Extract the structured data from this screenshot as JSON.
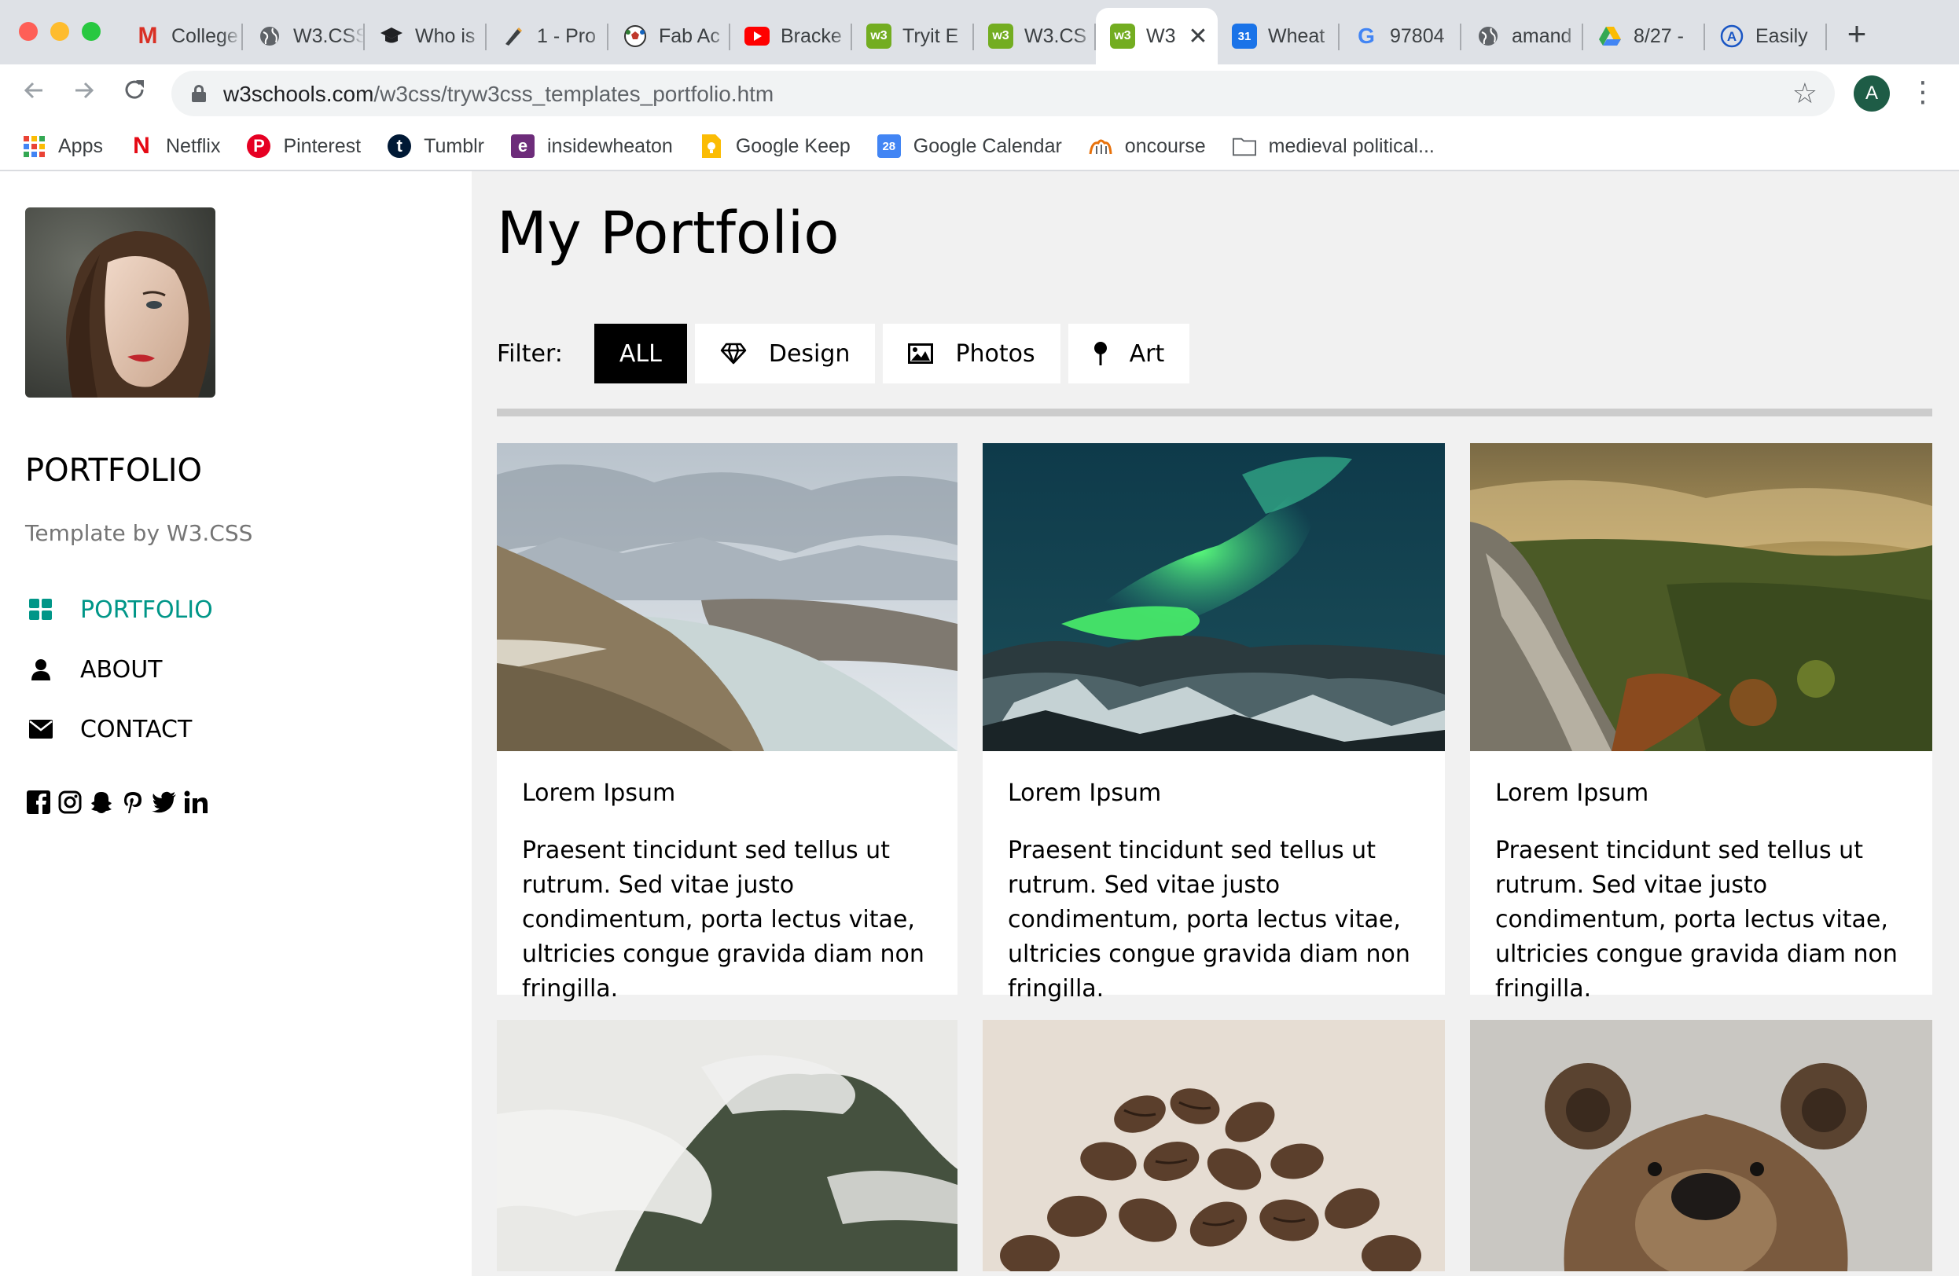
{
  "browser": {
    "tabs": [
      {
        "title": "College",
        "icon": "gmail-icon"
      },
      {
        "title": "W3.CSS",
        "icon": "globe-icon"
      },
      {
        "title": "Who is",
        "icon": "graduation-cap-icon"
      },
      {
        "title": "1 - Pro",
        "icon": "pen-icon"
      },
      {
        "title": "Fab Ac",
        "icon": "soccer-ball-icon"
      },
      {
        "title": "Bracke",
        "icon": "youtube-icon"
      },
      {
        "title": "Tryit E",
        "icon": "w3schools-icon"
      },
      {
        "title": "W3.CS",
        "icon": "w3schools-icon"
      },
      {
        "title": "W3",
        "icon": "w3schools-icon",
        "active": true
      },
      {
        "title": "Wheat",
        "icon": "calendar-icon"
      },
      {
        "title": "97804",
        "icon": "google-icon"
      },
      {
        "title": "amand",
        "icon": "globe-icon"
      },
      {
        "title": "8/27 -",
        "icon": "drive-icon"
      },
      {
        "title": "Easily",
        "icon": "a-logo-icon"
      }
    ],
    "url_host": "w3schools.com",
    "url_path": "/w3css/tryw3css_templates_portfolio.htm",
    "profile_initial": "A",
    "calendar_day": "31"
  },
  "bookmarks": [
    {
      "label": "Apps",
      "icon": "apps-grid-icon"
    },
    {
      "label": "Netflix",
      "icon": "netflix-icon"
    },
    {
      "label": "Pinterest",
      "icon": "pinterest-icon"
    },
    {
      "label": "Tumblr",
      "icon": "tumblr-icon"
    },
    {
      "label": "insidewheaton",
      "icon": "e-logo-icon"
    },
    {
      "label": "Google Keep",
      "icon": "keep-icon"
    },
    {
      "label": "Google Calendar",
      "icon": "calendar-icon"
    },
    {
      "label": "oncourse",
      "icon": "oncourse-icon"
    },
    {
      "label": "medieval political...",
      "icon": "folder-icon"
    }
  ],
  "bookmark_calendar_day": "28",
  "sidebar": {
    "brand": "PORTFOLIO",
    "tagline": "Template by W3.CSS",
    "nav": [
      {
        "label": "PORTFOLIO",
        "icon": "grid-icon",
        "active": true
      },
      {
        "label": "ABOUT",
        "icon": "user-icon"
      },
      {
        "label": "CONTACT",
        "icon": "envelope-icon"
      }
    ],
    "socials": [
      "facebook-icon",
      "instagram-icon",
      "snapchat-icon",
      "pinterest-icon",
      "twitter-icon",
      "linkedin-icon"
    ]
  },
  "main": {
    "heading": "My Portfolio",
    "filter_label": "Filter:",
    "filters": [
      {
        "label": "ALL",
        "active": true
      },
      {
        "label": "Design",
        "icon": "diamond-icon"
      },
      {
        "label": "Photos",
        "icon": "image-icon"
      },
      {
        "label": "Art",
        "icon": "map-pin-icon"
      }
    ],
    "cards": [
      {
        "title": "Lorem Ipsum",
        "text": "Praesent tincidunt sed tellus ut rutrum. Sed vitae justo condimentum, porta lectus vitae, ultricies congue gravida diam non fringilla.",
        "photo": "mountain-lake-photo"
      },
      {
        "title": "Lorem Ipsum",
        "text": "Praesent tincidunt sed tellus ut rutrum. Sed vitae justo condimentum, porta lectus vitae, ultricies congue gravida diam non fringilla.",
        "photo": "northern-lights-photo"
      },
      {
        "title": "Lorem Ipsum",
        "text": "Praesent tincidunt sed tellus ut rutrum. Sed vitae justo condimentum, porta lectus vitae, ultricies congue gravida diam non fringilla.",
        "photo": "forest-valley-photo"
      },
      {
        "photo": "misty-mountain-photo"
      },
      {
        "photo": "coffee-beans-photo"
      },
      {
        "photo": "bear-photo"
      }
    ]
  },
  "colors": {
    "accent": "#009688",
    "active_filter": "#000000",
    "page_bg": "#f1f1f1",
    "rule": "#cccccc"
  }
}
